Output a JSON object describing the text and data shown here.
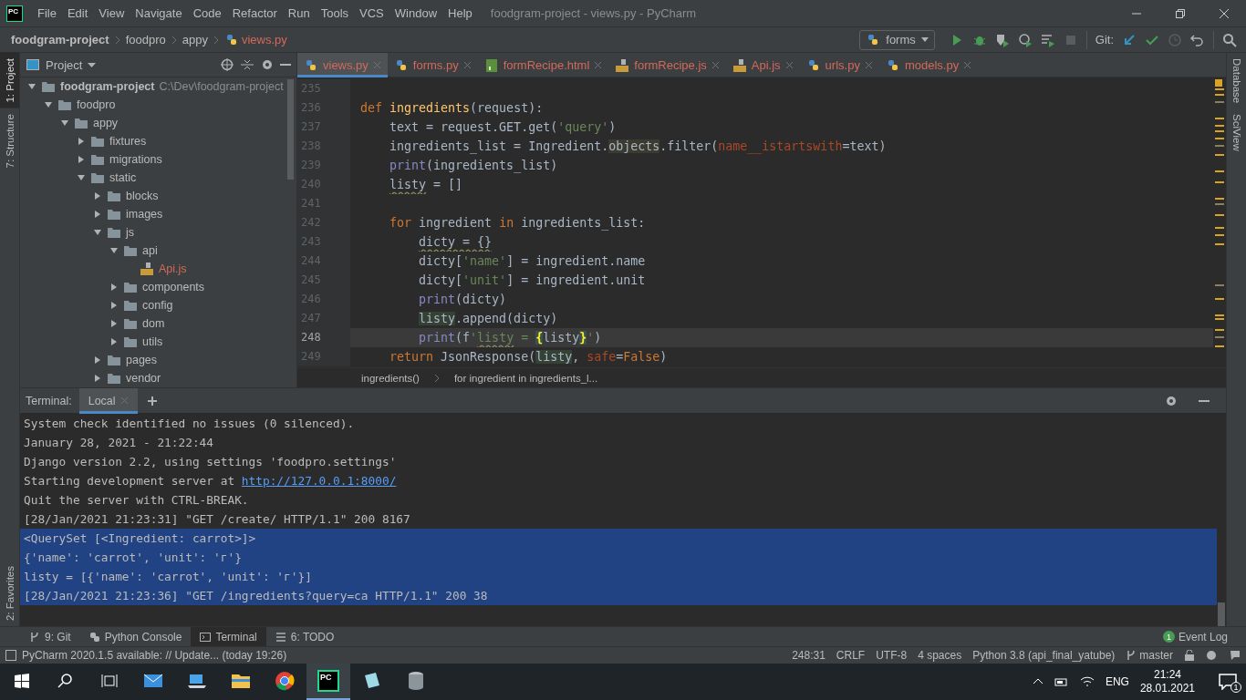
{
  "window": {
    "logo": "PC",
    "menu": [
      "File",
      "Edit",
      "View",
      "Navigate",
      "Code",
      "Refactor",
      "Run",
      "Tools",
      "VCS",
      "Window",
      "Help"
    ],
    "title": "foodgram-project - views.py - PyCharm"
  },
  "navbar": {
    "crumbs": [
      {
        "label": "foodgram-project",
        "kind": "project"
      },
      {
        "label": "foodpro",
        "kind": "folder"
      },
      {
        "label": "appy",
        "kind": "folder"
      },
      {
        "label": "views.py",
        "kind": "file"
      }
    ],
    "run_config": "forms",
    "git_label": "Git:"
  },
  "left_stripe": [
    {
      "label": "1: Project",
      "selected": true,
      "kind": "top"
    },
    {
      "label": "7: Structure",
      "selected": false,
      "kind": "top"
    },
    {
      "label": "2: Favorites",
      "selected": false,
      "kind": "bottom"
    }
  ],
  "right_stripe": [
    "Database",
    "SciView"
  ],
  "project": {
    "title": "Project",
    "tree": [
      {
        "label": "foodgram-project",
        "hint": "C:\\Dev\\foodgram-project",
        "kind": "root",
        "expanded": true,
        "children": [
          {
            "label": "foodpro",
            "kind": "folder",
            "expanded": true,
            "children": [
              {
                "label": "appy",
                "kind": "folder",
                "expanded": true,
                "children": [
                  {
                    "label": "fixtures",
                    "kind": "folder",
                    "expanded": false
                  },
                  {
                    "label": "migrations",
                    "kind": "folder",
                    "expanded": false
                  },
                  {
                    "label": "static",
                    "kind": "folder",
                    "expanded": true,
                    "children": [
                      {
                        "label": "blocks",
                        "kind": "folder",
                        "expanded": false
                      },
                      {
                        "label": "images",
                        "kind": "folder",
                        "expanded": false
                      },
                      {
                        "label": "js",
                        "kind": "folder",
                        "expanded": true,
                        "children": [
                          {
                            "label": "api",
                            "kind": "folder",
                            "expanded": true,
                            "children": [
                              {
                                "label": "Api.js",
                                "kind": "js"
                              }
                            ]
                          },
                          {
                            "label": "components",
                            "kind": "folder",
                            "expanded": false
                          },
                          {
                            "label": "config",
                            "kind": "folder",
                            "expanded": false
                          },
                          {
                            "label": "dom",
                            "kind": "folder",
                            "expanded": false
                          },
                          {
                            "label": "utils",
                            "kind": "folder",
                            "expanded": false
                          }
                        ]
                      },
                      {
                        "label": "pages",
                        "kind": "folder",
                        "expanded": false
                      },
                      {
                        "label": "vendor",
                        "kind": "folder",
                        "expanded": false
                      }
                    ]
                  }
                ]
              }
            ]
          }
        ]
      }
    ]
  },
  "tabs": [
    {
      "label": "views.py",
      "kind": "py",
      "selected": true
    },
    {
      "label": "forms.py",
      "kind": "py",
      "selected": false
    },
    {
      "label": "formRecipe.html",
      "kind": "html",
      "selected": false
    },
    {
      "label": "formRecipe.js",
      "kind": "js",
      "selected": false
    },
    {
      "label": "Api.js",
      "kind": "js",
      "selected": false
    },
    {
      "label": "urls.py",
      "kind": "py",
      "selected": false
    },
    {
      "label": "models.py",
      "kind": "py",
      "selected": false
    }
  ],
  "code": [
    {
      "number": "235",
      "current": false
    },
    {
      "number": "236",
      "current": false,
      "segments": [
        {
          "text": "def ",
          "kind": "keyword"
        },
        {
          "text": "ingredients",
          "kind": "function"
        },
        {
          "text": "(request):",
          "kind": "plain"
        }
      ]
    },
    {
      "number": "237",
      "current": false,
      "segments": [
        {
          "text": "    text = request.GET.get(",
          "kind": "plain"
        },
        {
          "text": "'query'",
          "kind": "string"
        },
        {
          "text": ")",
          "kind": "plain"
        }
      ]
    },
    {
      "number": "238",
      "current": false,
      "segments": [
        {
          "text": "    ingredients_list = Ingredient.",
          "kind": "plain"
        },
        {
          "text": "objects",
          "kind": "usage"
        },
        {
          "text": ".filter(",
          "kind": "plain"
        },
        {
          "text": "name__istartswith",
          "kind": "param"
        },
        {
          "text": "=text)",
          "kind": "plain"
        }
      ]
    },
    {
      "number": "239",
      "current": false,
      "segments": [
        {
          "text": "    print",
          "kind": "builtin"
        },
        {
          "text": "(ingredients_list)",
          "kind": "plain"
        }
      ]
    },
    {
      "number": "240",
      "current": false,
      "segments": [
        {
          "text": "    listy",
          "kind": "warn"
        },
        {
          "text": " = []",
          "kind": "plain"
        }
      ]
    },
    {
      "number": "241",
      "current": false
    },
    {
      "number": "242",
      "current": false,
      "segments": [
        {
          "text": "    for ",
          "kind": "keyword"
        },
        {
          "text": "ingredient ",
          "kind": "plain"
        },
        {
          "text": "in ",
          "kind": "keyword"
        },
        {
          "text": "ingredients_list:",
          "kind": "plain"
        }
      ]
    },
    {
      "number": "243",
      "current": false,
      "segments": [
        {
          "text": "        dicty = {}",
          "kind": "warn"
        }
      ]
    },
    {
      "number": "244",
      "current": false,
      "segments": [
        {
          "text": "        dicty[",
          "kind": "plain"
        },
        {
          "text": "'name'",
          "kind": "string"
        },
        {
          "text": "] = ingredient.name",
          "kind": "plain"
        }
      ]
    },
    {
      "number": "245",
      "current": false,
      "segments": [
        {
          "text": "        dicty[",
          "kind": "plain"
        },
        {
          "text": "'unit'",
          "kind": "string"
        },
        {
          "text": "] = ingredient.unit",
          "kind": "plain"
        }
      ]
    },
    {
      "number": "246",
      "current": false,
      "segments": [
        {
          "text": "        print",
          "kind": "builtin"
        },
        {
          "text": "(dicty)",
          "kind": "plain"
        }
      ]
    },
    {
      "number": "247",
      "current": false,
      "segments": [
        {
          "text": "        listy",
          "kind": "write"
        },
        {
          "text": ".append(dicty)",
          "kind": "plain"
        }
      ]
    },
    {
      "number": "248",
      "current": true,
      "segments": [
        {
          "text": "        print",
          "kind": "builtin"
        },
        {
          "text": "(f",
          "kind": "plain"
        },
        {
          "text": "'",
          "kind": "string"
        },
        {
          "text": "listy",
          "kind": "string-warn"
        },
        {
          "text": " = ",
          "kind": "string"
        },
        {
          "text": "{",
          "kind": "brace"
        },
        {
          "text": "listy",
          "kind": "plain"
        },
        {
          "text": "}",
          "kind": "brace"
        },
        {
          "text": "'",
          "kind": "string"
        },
        {
          "text": ")",
          "kind": "plain"
        }
      ]
    },
    {
      "number": "249",
      "current": false,
      "segments": [
        {
          "text": "    return ",
          "kind": "keyword"
        },
        {
          "text": "JsonResponse(",
          "kind": "plain"
        },
        {
          "text": "listy",
          "kind": "write"
        },
        {
          "text": ", ",
          "kind": "plain"
        },
        {
          "text": "safe",
          "kind": "param"
        },
        {
          "text": "=",
          "kind": "plain"
        },
        {
          "text": "False",
          "kind": "keyword"
        },
        {
          "text": ")",
          "kind": "plain"
        }
      ]
    }
  ],
  "editor_breadcrumbs": [
    "ingredients()",
    "for ingredient in ingredients_l..."
  ],
  "terminal": {
    "label": "Terminal:",
    "tabs": [
      {
        "label": "Local",
        "selected": true
      }
    ],
    "lines": [
      {
        "selected": false,
        "segments": [
          {
            "text": "System check identified no issues (0 silenced).",
            "link": false
          }
        ]
      },
      {
        "selected": false,
        "segments": [
          {
            "text": "January 28, 2021 - 21:22:44",
            "link": false
          }
        ]
      },
      {
        "selected": false,
        "segments": [
          {
            "text": "Django version 2.2, using settings 'foodpro.settings'",
            "link": false
          }
        ]
      },
      {
        "selected": false,
        "segments": [
          {
            "text": "Starting development server at ",
            "link": false
          },
          {
            "text": "http://127.0.0.1:8000/",
            "link": true
          }
        ]
      },
      {
        "selected": false,
        "segments": [
          {
            "text": "Quit the server with CTRL-BREAK.",
            "link": false
          }
        ]
      },
      {
        "selected": false,
        "segments": [
          {
            "text": "[28/Jan/2021 21:23:31] \"GET /create/ HTTP/1.1\" 200 8167",
            "link": false
          }
        ]
      },
      {
        "selected": true,
        "segments": [
          {
            "text": "<QuerySet [<Ingredient: carrot>]>",
            "link": false
          }
        ]
      },
      {
        "selected": true,
        "segments": [
          {
            "text": "{'name': 'carrot', 'unit': 'г'}",
            "link": false
          }
        ]
      },
      {
        "selected": true,
        "segments": [
          {
            "text": "listy = [{'name': 'carrot', 'unit': 'г'}]",
            "link": false
          }
        ]
      },
      {
        "selected": true,
        "segments": [
          {
            "text": "[28/Jan/2021 21:23:36] \"GET /ingredients?query=ca HTTP/1.1\" 200 38",
            "link": false
          }
        ]
      }
    ]
  },
  "tool_windows": [
    {
      "label": "9: Git",
      "kind": "git",
      "selected": false
    },
    {
      "label": "Python Console",
      "kind": "python",
      "selected": false
    },
    {
      "label": "Terminal",
      "kind": "terminal",
      "selected": true
    },
    {
      "label": "6: TODO",
      "kind": "todo",
      "selected": false
    }
  ],
  "event_log": {
    "label": "Event Log",
    "count": "1"
  },
  "status_bar": {
    "message": "PyCharm 2020.1.5 available: // Update... (today 19:26)",
    "items": [
      "248:31",
      "CRLF",
      "UTF-8",
      "4 spaces",
      "Python 3.8 (api_final_yatube)"
    ],
    "branch": "master"
  },
  "taskbar": {
    "apps": [
      {
        "kind": "mail",
        "active": false
      },
      {
        "kind": "laptop",
        "active": false
      },
      {
        "kind": "folder",
        "active": false
      },
      {
        "kind": "browser",
        "active": false
      },
      {
        "kind": "pycharm",
        "label": "PC",
        "active": true
      },
      {
        "kind": "notepad",
        "active": false
      },
      {
        "kind": "database",
        "active": false
      }
    ],
    "language": "ENG",
    "time": "21:24",
    "date": "28.01.2021",
    "notifications": "1"
  }
}
